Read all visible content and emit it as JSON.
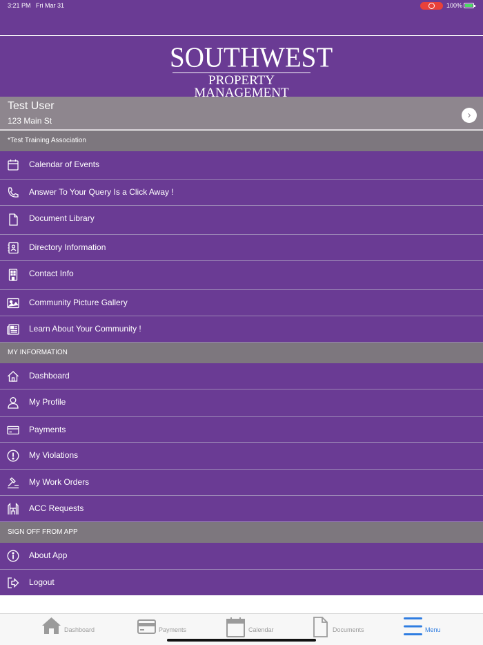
{
  "status_bar": {
    "time": "3:21 PM",
    "date": "Fri Mar 31",
    "battery": "100%"
  },
  "logo": {
    "line1": "SOUTHWEST",
    "line2": "PROPERTY MANAGEMENT"
  },
  "user": {
    "name": "Test User",
    "address": "123 Main St",
    "chevron": "›"
  },
  "sections": {
    "association": "*Test Training Association",
    "my_information": "MY INFORMATION",
    "sign_off": "SIGN OFF FROM APP"
  },
  "association_items": [
    {
      "label": "Calendar of Events",
      "icon": "calendar-icon"
    },
    {
      "label": "Answer To Your Query Is a Click Away !",
      "icon": "phone-icon"
    },
    {
      "label": "Document Library",
      "icon": "document-icon"
    },
    {
      "label": "Directory Information",
      "icon": "contact-card-icon"
    },
    {
      "label": "Contact Info",
      "icon": "building-icon"
    },
    {
      "label": "Community Picture Gallery",
      "icon": "image-icon"
    },
    {
      "label": "Learn About Your Community !",
      "icon": "newspaper-icon"
    }
  ],
  "my_info_items": [
    {
      "label": "Dashboard",
      "icon": "home-icon"
    },
    {
      "label": "My Profile",
      "icon": "person-icon"
    },
    {
      "label": "Payments",
      "icon": "credit-card-icon"
    },
    {
      "label": "My Violations",
      "icon": "alert-circle-icon"
    },
    {
      "label": "My Work Orders",
      "icon": "hammer-icon"
    },
    {
      "label": "ACC Requests",
      "icon": "acc-icon"
    }
  ],
  "sign_off_items": [
    {
      "label": "About App",
      "icon": "info-icon"
    },
    {
      "label": "Logout",
      "icon": "logout-icon"
    }
  ],
  "tabs": [
    {
      "label": "Dashboard",
      "icon": "home-icon"
    },
    {
      "label": "Payments",
      "icon": "credit-card-icon"
    },
    {
      "label": "Calendar",
      "icon": "calendar-icon"
    },
    {
      "label": "Documents",
      "icon": "document-icon"
    },
    {
      "label": "Menu",
      "icon": "hamburger-icon",
      "active": true
    }
  ],
  "colors": {
    "brand_purple": "#6a3b94",
    "section_gray": "#7d777e",
    "user_row_gray": "#8e868e",
    "active_tab_blue": "#2f7de1"
  }
}
